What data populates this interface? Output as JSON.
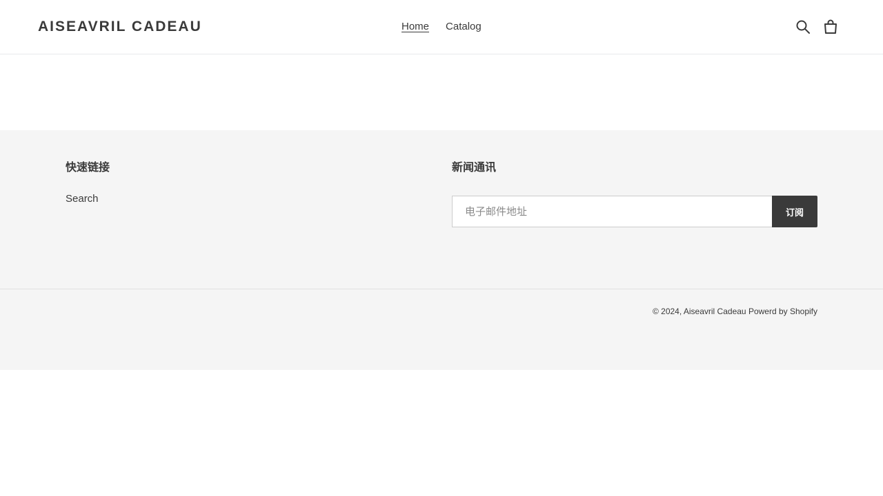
{
  "header": {
    "logo": "AISEAVRIL CADEAU",
    "nav": [
      {
        "label": "Home",
        "active": true
      },
      {
        "label": "Catalog",
        "active": false
      }
    ],
    "icons": [
      "search-icon",
      "cart-icon"
    ]
  },
  "footer": {
    "quick_links": {
      "heading": "快速链接",
      "items": [
        "Search"
      ]
    },
    "newsletter": {
      "heading": "新闻通讯",
      "email_placeholder": "电子邮件地址",
      "subscribe_label": "订阅"
    },
    "copyright_prefix": "© 2024,",
    "store_name": "Aiseavril Cadeau",
    "powered_by": "Powerd by Shopify"
  },
  "colors": {
    "text": "#3a3a3a",
    "footer_bg": "#f5f5f5",
    "button_bg": "#3a3a3a",
    "button_text": "#ffffff"
  }
}
